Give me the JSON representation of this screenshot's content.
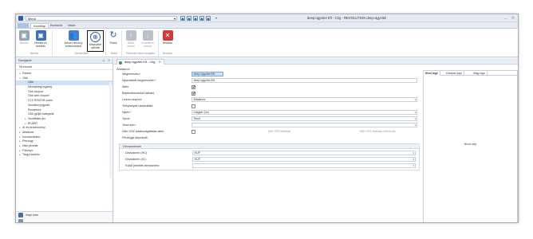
{
  "titlebar": {
    "menu_label": "Menü",
    "window_title": "deep.ügyvitel Kft - Cég - REVOLUTION deep.ügyvitel",
    "quick_access": [
      "◼",
      "◼",
      "◼",
      "◼",
      "◼",
      "▾"
    ]
  },
  "tabs": [
    "",
    "Kezdőlap",
    "Eszközök",
    "Nézet"
  ],
  "ribbon": {
    "buttons": [
      {
        "label": "Mentés",
        "icon": "save-icon",
        "enabled": false
      },
      {
        "label": "Mentés és bezárás",
        "icon": "save-close-icon",
        "enabled": true
      },
      {
        "label": "Active Directory szinkronizáció",
        "icon": "users-sync-icon",
        "enabled": true
      },
      {
        "label": "Megnyitott nyelvek",
        "icon": "globe-icon",
        "enabled": true,
        "selected": true
      },
      {
        "label": "Frissít",
        "icon": "refresh-icon",
        "enabled": true
      },
      {
        "label": "Előző rekord",
        "icon": "arrow-up-icon",
        "enabled": false
      },
      {
        "label": "Következő rekord",
        "icon": "arrow-down-icon",
        "enabled": false
      },
      {
        "label": "Bezárás",
        "icon": "close-red-icon",
        "enabled": true
      }
    ],
    "groups": [
      "Mentés",
      "Szerkesztés",
      "Nézet",
      "Rekordok közti navigálás",
      "Bezárás"
    ]
  },
  "sidebar": {
    "header": "Navigáció",
    "section": "Törzsadat",
    "tree": [
      {
        "label": "Partner",
        "level": 0,
        "toggle": "▸"
      },
      {
        "label": "Cikk",
        "level": 0,
        "toggle": "▾"
      },
      {
        "label": "Cikk",
        "level": 1,
        "toggle": "",
        "selected": true
      },
      {
        "label": "Mennyiségi egység",
        "level": 1,
        "toggle": ""
      },
      {
        "label": "Cikk csoport",
        "level": 1,
        "toggle": ""
      },
      {
        "label": "Cikk web csoport",
        "level": 1,
        "toggle": ""
      },
      {
        "label": "VTJ/TESZOR szám",
        "level": 1,
        "toggle": ""
      },
      {
        "label": "Vonalkód jegyzék",
        "level": 1,
        "toggle": ""
      },
      {
        "label": "Receptúra",
        "level": 1,
        "toggle": ""
      },
      {
        "label": "Cikk gyűjtő kategória",
        "level": 1,
        "toggle": ""
      },
      {
        "label": "Vezetékes áru",
        "level": 1,
        "toggle": "▸"
      },
      {
        "label": "EKÁER",
        "level": 1,
        "toggle": "▸"
      },
      {
        "label": "Ár és kedvezmény",
        "level": 0,
        "toggle": "▸"
      },
      {
        "label": "Általános",
        "level": 0,
        "toggle": "▸"
      },
      {
        "label": "Kereskedelem",
        "level": 0,
        "toggle": "▸"
      },
      {
        "label": "Pénzügy",
        "level": 0,
        "toggle": "▸"
      },
      {
        "label": "Házi pénztár",
        "level": 0,
        "toggle": "▸"
      },
      {
        "label": "Főkönyv",
        "level": 0,
        "toggle": "▸"
      },
      {
        "label": "Tárgyi eszköz",
        "level": 0,
        "toggle": "▸"
      }
    ],
    "bottom": [
      "Napi rutin",
      ""
    ]
  },
  "main": {
    "tab_label": "deep.ügyvitel Kft - Cég",
    "section": "Általános",
    "fields": [
      {
        "label": "Megnevezés:*",
        "type": "text",
        "value": "deep.ügyvitel Kft",
        "highlight": true
      },
      {
        "label": "Nyomtatott megnevezés:*",
        "type": "text",
        "value": "deep.ügyvitel Kft"
      },
      {
        "label": "Aktív",
        "type": "check",
        "value": "✔"
      },
      {
        "label": "Bejelentkezéskor látható",
        "type": "check",
        "value": "✔"
      },
      {
        "label": "Licenc csoport:",
        "type": "select",
        "value": "Általános"
      },
      {
        "label": "Telephelyek használata",
        "type": "check",
        "value": ""
      },
      {
        "label": "Nyelv:*",
        "type": "select",
        "value": "magyar (hu)"
      },
      {
        "label": "Típus:",
        "type": "select",
        "value": "Teszt"
      },
      {
        "label": "Teszt szín:",
        "type": "select",
        "value": ""
      },
      {
        "label": "NAV OSZ adatszolgáltatás aktív",
        "type": "check",
        "value": ""
      },
      {
        "label": "Pénzügyi képviselő:",
        "type": "none",
        "value": ""
      }
    ],
    "nav_links": [
      "NAV OSZ beállítás",
      "NAV OSZ beállítás ellenőrzés"
    ],
    "currency_group": {
      "title": "Devizanemek",
      "fields": [
        {
          "label": "Devizanem (HC):",
          "value": "HUF"
        },
        {
          "label": "Devizanem (IC):",
          "value": "HUF"
        },
        {
          "label": "Külső jelentés devizanem:",
          "value": ""
        }
      ]
    },
    "logo_tabs": [
      "Kicsi logo",
      "Közepes logo",
      "Nagy logo"
    ],
    "no_image": "Nincs kép"
  }
}
